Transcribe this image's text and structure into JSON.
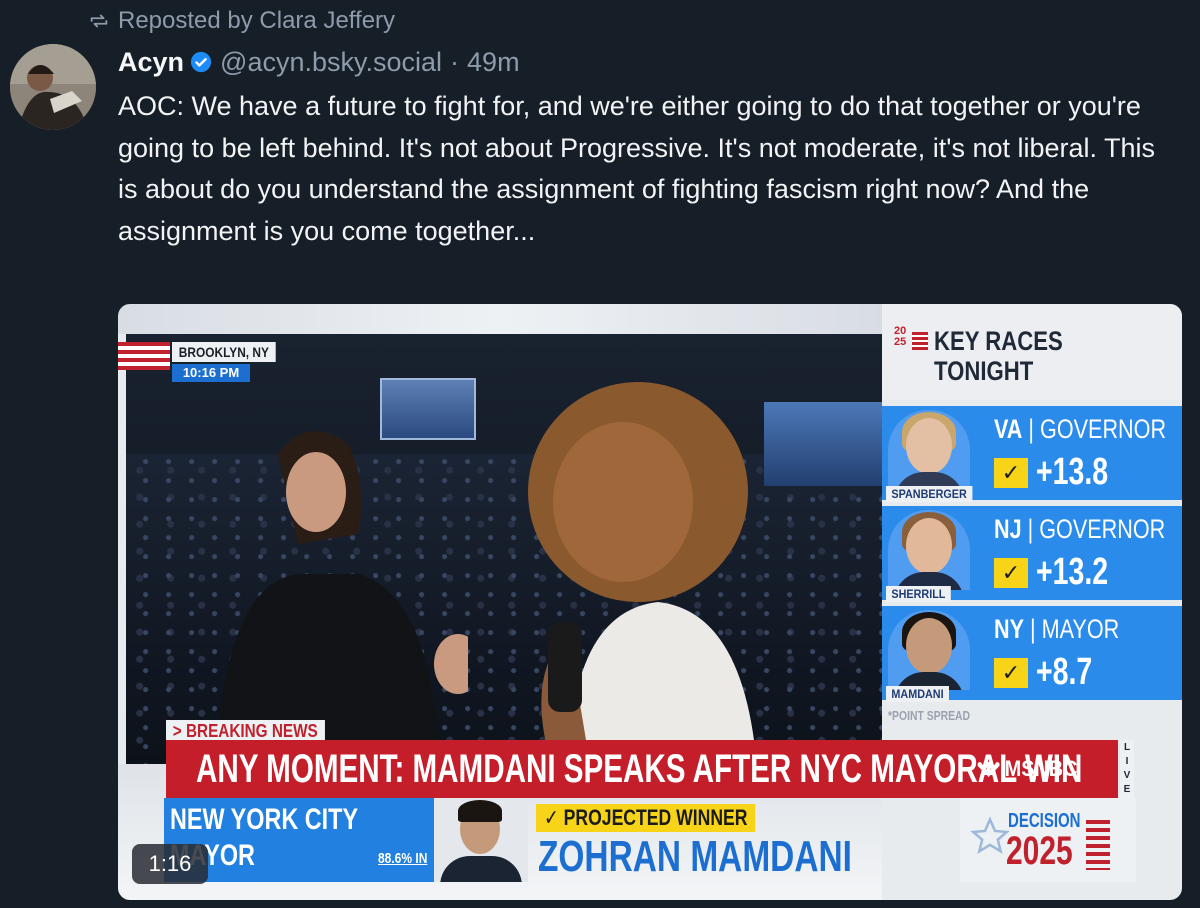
{
  "repost": {
    "icon": "repost-icon",
    "text": "Reposted by Clara Jeffery"
  },
  "post": {
    "author": "Acyn",
    "verified_icon": "verified-check-icon",
    "handle": "@acyn.bsky.social",
    "separator": "·",
    "time": "49m",
    "text": "AOC: We have a future to fight for, and we're either going to do that together or you're going to be left behind. It's not about Progressive. It's not moderate, it's not liberal. This is about do you understand the assignment of fighting fascism right now? And the assignment is you come together..."
  },
  "video": {
    "duration": "1:16",
    "location": "BROOKLYN, NY",
    "clock": "10:16 PM",
    "panel": {
      "badge_top": "20",
      "badge_bottom": "25",
      "title_line1": "KEY RACES",
      "title_line2": "TONIGHT",
      "races": [
        {
          "state": "VA",
          "office": "GOVERNOR",
          "check": "✓",
          "spread": "+13.8",
          "candidate": "SPANBERGER"
        },
        {
          "state": "NJ",
          "office": "GOVERNOR",
          "check": "✓",
          "spread": "+13.2",
          "candidate": "SHERRILL"
        },
        {
          "state": "NY",
          "office": "MAYOR",
          "check": "✓",
          "spread": "+8.7",
          "candidate": "MAMDANI"
        }
      ],
      "note": "*POINT SPREAD"
    },
    "breaking": "> BREAKING NEWS",
    "headline": "ANY MOMENT: MAMDANI SPEAKS AFTER NYC MAYORAL WIN",
    "network": "MSNBC",
    "live": [
      "L",
      "I",
      "V",
      "E"
    ],
    "race_line1": "NEW YORK CITY",
    "race_line2": "MAYOR",
    "reporting": "88.6% IN",
    "projected": "✓ PROJECTED WINNER",
    "winner": "ZOHRAN MAMDANI",
    "decision_line1": "DECISION",
    "decision_line2": "2025"
  }
}
